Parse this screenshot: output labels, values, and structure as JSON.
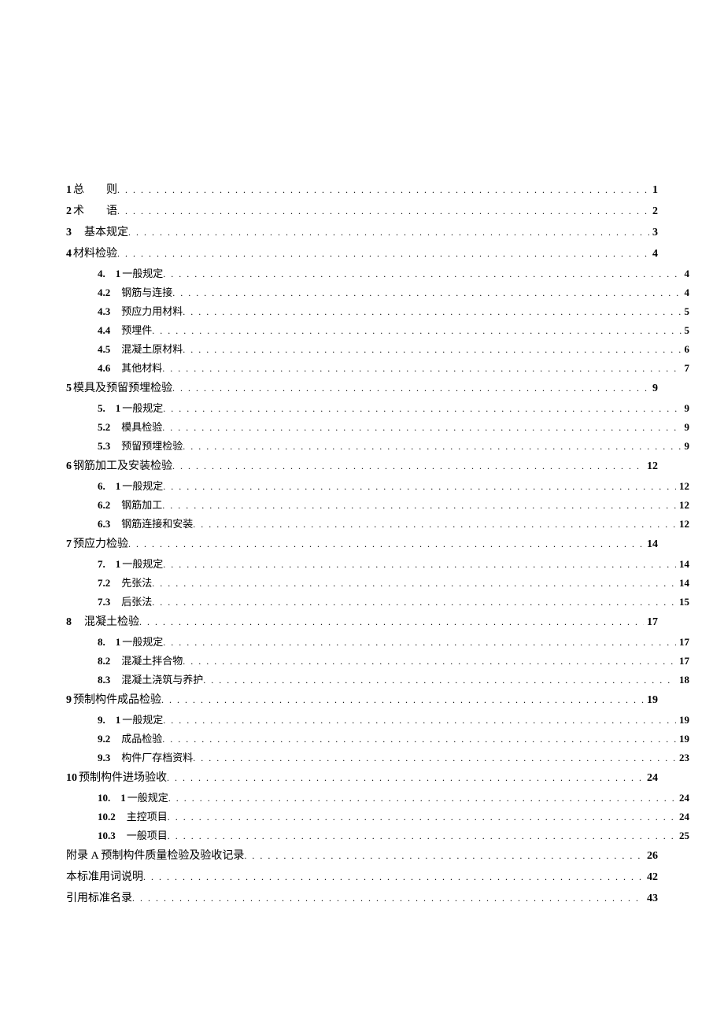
{
  "toc": [
    {
      "level": 1,
      "num": "1",
      "title": "总　　则",
      "page": "1",
      "cls": ""
    },
    {
      "level": 1,
      "num": "2",
      "title": "术　　语",
      "page": "2",
      "cls": ""
    },
    {
      "level": 1,
      "num": "3",
      "title": "　基本规定",
      "page": "3",
      "cls": ""
    },
    {
      "level": 1,
      "num": "4",
      "title": "材料检验",
      "page": "4",
      "cls": ""
    },
    {
      "level": 2,
      "num": "4.　1",
      "title": "一般规定",
      "page": "4",
      "cls": "nosp"
    },
    {
      "level": 2,
      "num": "4.2",
      "title": "钢筋与连接",
      "page": "4",
      "cls": ""
    },
    {
      "level": 2,
      "num": "4.3",
      "title": "预应力用材料",
      "page": "5",
      "cls": ""
    },
    {
      "level": 2,
      "num": "4.4",
      "title": "预埋件",
      "page": "5",
      "cls": ""
    },
    {
      "level": 2,
      "num": "4.5",
      "title": "混凝土原材料",
      "page": "6",
      "cls": ""
    },
    {
      "level": 2,
      "num": "4.6",
      "title": "其他材料",
      "page": "7",
      "cls": ""
    },
    {
      "level": 1,
      "num": "5",
      "title": "模具及预留预埋检验",
      "page": "9",
      "cls": ""
    },
    {
      "level": 2,
      "num": "5.　1",
      "title": "一般规定",
      "page": "9",
      "cls": "nosp"
    },
    {
      "level": 2,
      "num": "5.2",
      "title": "模具检验",
      "page": "9",
      "cls": ""
    },
    {
      "level": 2,
      "num": "5.3",
      "title": "预留预埋检验",
      "page": "9",
      "cls": ""
    },
    {
      "level": 1,
      "num": "6",
      "title": "钢筋加工及安装检验",
      "page": "12",
      "cls": ""
    },
    {
      "level": 2,
      "num": "6.　1",
      "title": "一般规定",
      "page": "12",
      "cls": "nosp"
    },
    {
      "level": 2,
      "num": "6.2",
      "title": "钢筋加工",
      "page": "12",
      "cls": ""
    },
    {
      "level": 2,
      "num": "6.3",
      "title": "钢筋连接和安装",
      "page": "12",
      "cls": ""
    },
    {
      "level": 1,
      "num": "7",
      "title": "预应力检验",
      "page": "14",
      "cls": ""
    },
    {
      "level": 2,
      "num": "7.　1",
      "title": "一般规定",
      "page": "14",
      "cls": "nosp"
    },
    {
      "level": 2,
      "num": "7.2",
      "title": "先张法",
      "page": "14",
      "cls": ""
    },
    {
      "level": 2,
      "num": "7.3",
      "title": "后张法",
      "page": "15",
      "cls": ""
    },
    {
      "level": 1,
      "num": "8",
      "title": "　混凝土检验",
      "page": "17",
      "cls": ""
    },
    {
      "level": 2,
      "num": "8.　1",
      "title": "一般规定",
      "page": "17",
      "cls": "nosp"
    },
    {
      "level": 2,
      "num": "8.2",
      "title": "混凝土拌合物",
      "page": "17",
      "cls": ""
    },
    {
      "level": 2,
      "num": "8.3",
      "title": "混凝土浇筑与养护",
      "page": "18",
      "cls": ""
    },
    {
      "level": 1,
      "num": "9",
      "title": "预制构件成品检验",
      "page": "19",
      "cls": ""
    },
    {
      "level": 2,
      "num": "9.　1",
      "title": "一般规定",
      "page": "19",
      "cls": "nosp"
    },
    {
      "level": 2,
      "num": "9.2",
      "title": "成品检验",
      "page": "19",
      "cls": ""
    },
    {
      "level": 2,
      "num": "9.3",
      "title": "构件厂存档资料",
      "page": "23",
      "cls": ""
    },
    {
      "level": 1,
      "num": "10",
      "title": "预制构件进场验收",
      "page": "24",
      "cls": ""
    },
    {
      "level": 2,
      "num": "10.　1",
      "title": "一般规定",
      "page": "24",
      "cls": "nosp"
    },
    {
      "level": 2,
      "num": "10.2",
      "title": "主控项目",
      "page": "24",
      "cls": ""
    },
    {
      "level": 2,
      "num": "10.3",
      "title": "一般项目",
      "page": "25",
      "cls": ""
    },
    {
      "level": 1,
      "num": "",
      "title": "附录 A 预制构件质量检验及验收记录",
      "page": "26",
      "cls": ""
    },
    {
      "level": 1,
      "num": "",
      "title": "本标准用词说明",
      "page": "42",
      "cls": ""
    },
    {
      "level": 1,
      "num": "",
      "title": "引用标准名录",
      "page": "43",
      "cls": ""
    }
  ]
}
